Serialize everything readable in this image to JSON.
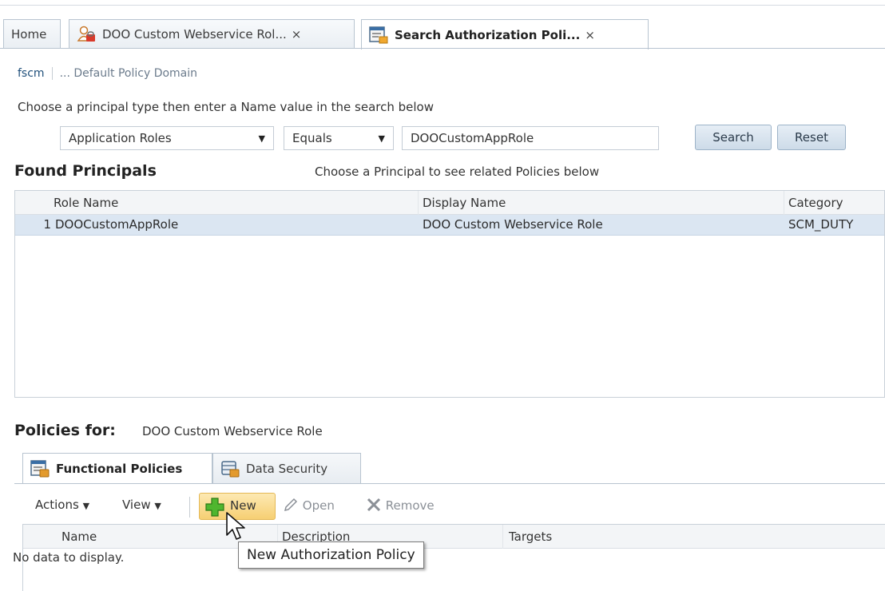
{
  "tabs": [
    {
      "label": "Home",
      "icon": "home-icon"
    },
    {
      "label": "DOO Custom Webservice Rol...",
      "icon": "role-icon",
      "close": "×"
    },
    {
      "label": "Search Authorization Poli...",
      "icon": "policy-search-icon",
      "close": "×"
    }
  ],
  "breadcrumb": {
    "root": "fscm",
    "current": "... Default Policy Domain"
  },
  "instructions": "Choose a principal type then enter a Name value in the search below",
  "search": {
    "principal_type": "Application Roles",
    "operator": "Equals",
    "value": "DOOCustomAppRole",
    "search_label": "Search",
    "reset_label": "Reset"
  },
  "found_principals": {
    "title": "Found Principals",
    "hint": "Choose a Principal to see related Policies below",
    "columns": [
      "Role Name",
      "Display Name",
      "Category"
    ],
    "rows": [
      {
        "num": "1",
        "role_name": "DOOCustomAppRole",
        "display_name": "DOO Custom Webservice Role",
        "category": "SCM_DUTY"
      }
    ]
  },
  "policies": {
    "label": "Policies for:",
    "value": "DOO Custom Webservice Role",
    "tabs": [
      "Functional Policies",
      "Data Security"
    ],
    "toolbar": {
      "actions": "Actions",
      "view": "View",
      "new": "New",
      "open": "Open",
      "remove": "Remove"
    },
    "columns": [
      "Name",
      "Description",
      "Targets"
    ],
    "empty": "No data to display."
  },
  "tooltip": "New Authorization Policy",
  "colors": {
    "accent_row": "#dbe6f2",
    "new_button": "#f6cf73",
    "tab_border": "#b8c4d0"
  }
}
